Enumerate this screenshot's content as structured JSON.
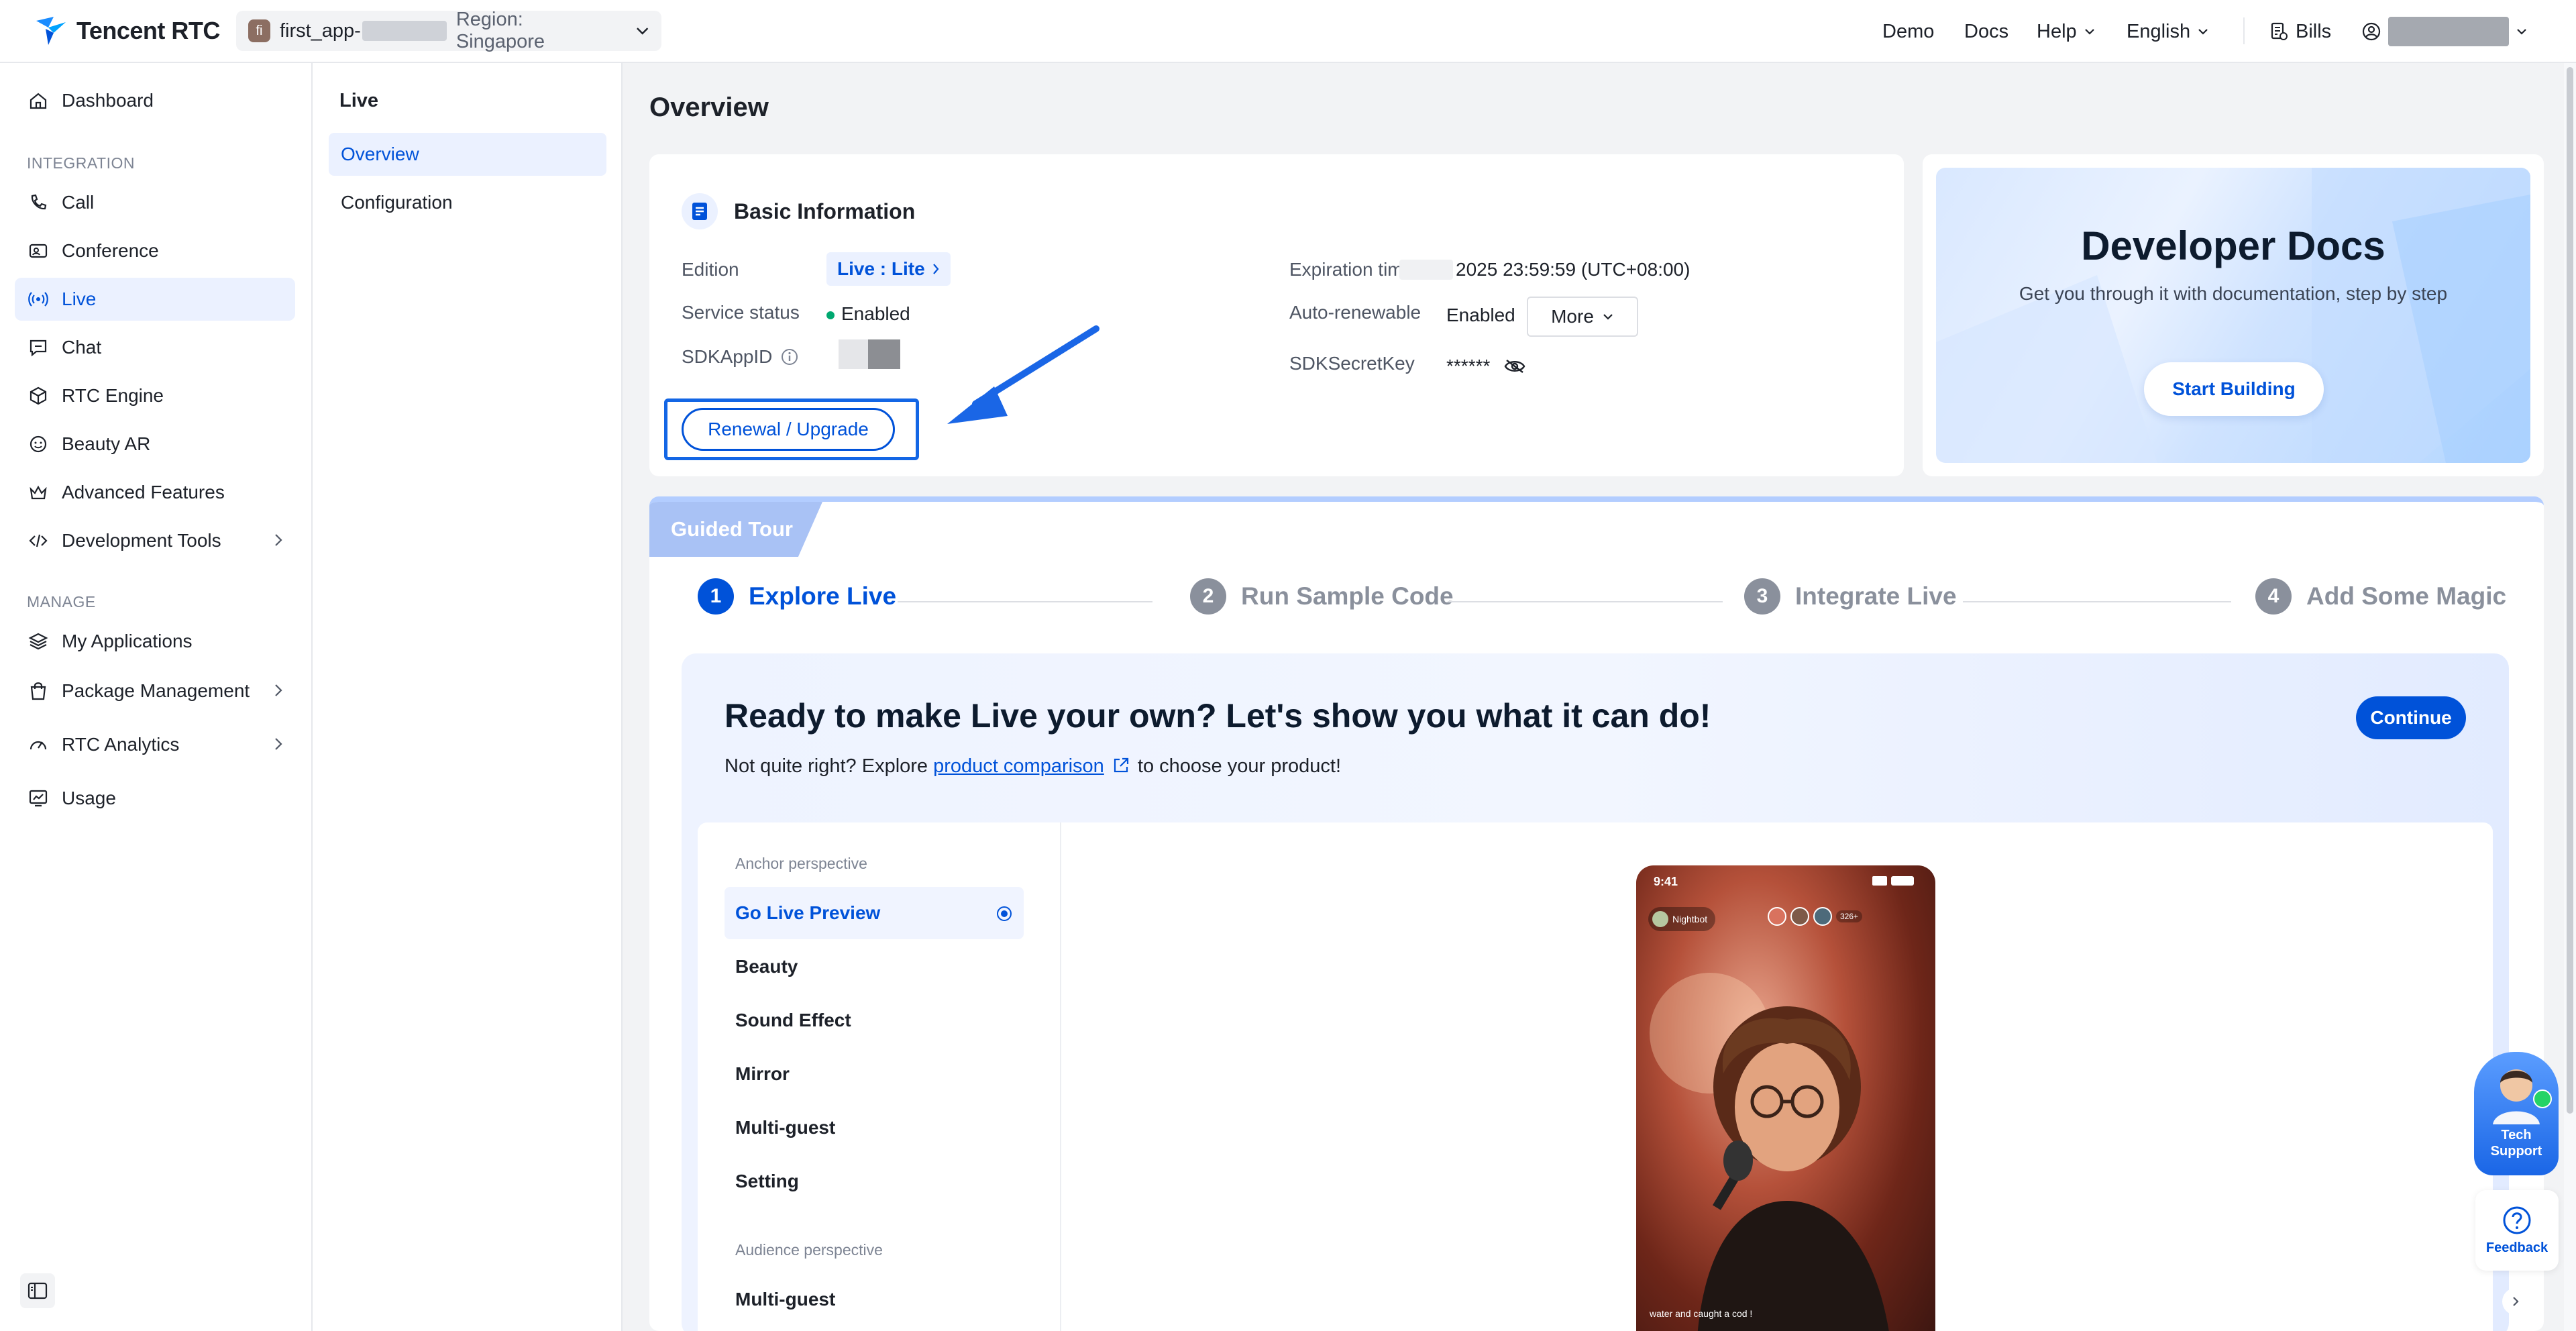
{
  "topbar": {
    "logo_text": "Tencent RTC",
    "app": {
      "avatar_letter": "fi",
      "name": "first_app-",
      "region": "Region: Singapore"
    },
    "nav": {
      "demo": "Demo",
      "docs": "Docs",
      "help": "Help",
      "language": "English",
      "bills": "Bills"
    }
  },
  "sidebar": {
    "dashboard": "Dashboard",
    "integration_label": "INTEGRATION",
    "call": "Call",
    "conference": "Conference",
    "live": "Live",
    "chat": "Chat",
    "rtc_engine": "RTC Engine",
    "beauty_ar": "Beauty AR",
    "advanced_features": "Advanced Features",
    "development_tools": "Development Tools",
    "manage_label": "MANAGE",
    "my_applications": "My Applications",
    "package_management": "Package Management",
    "rtc_analytics": "RTC Analytics",
    "usage": "Usage"
  },
  "subnav": {
    "title": "Live",
    "overview": "Overview",
    "configuration": "Configuration"
  },
  "page": {
    "title": "Overview"
  },
  "basic": {
    "title": "Basic Information",
    "edition_label": "Edition",
    "edition_value": "Live : Lite",
    "service_status_label": "Service status",
    "service_status_value": "Enabled",
    "sdkappid_label": "SDKAppID",
    "expiration_label": "Expiration time",
    "expiration_value": "2025 23:59:59 (UTC+08:00)",
    "auto_renew_label": "Auto-renewable",
    "auto_renew_value": "Enabled",
    "more_button": "More",
    "secret_label": "SDKSecretKey",
    "secret_value": "******",
    "renew_button": "Renewal / Upgrade"
  },
  "docs_card": {
    "title": "Developer Docs",
    "subtitle": "Get you through it with documentation, step by step",
    "button": "Start Building"
  },
  "tour": {
    "tab": "Guided Tour",
    "steps": [
      {
        "num": "1",
        "label": "Explore Live"
      },
      {
        "num": "2",
        "label": "Run Sample Code"
      },
      {
        "num": "3",
        "label": "Integrate Live"
      },
      {
        "num": "4",
        "label": "Add Some Magic"
      }
    ],
    "hero_title": "Ready to make Live your own? Let's show you what it can do!",
    "hero_sub_pre": "Not quite right? Explore ",
    "hero_link": "product comparison",
    "hero_sub_post": " to choose your product!",
    "continue": "Continue",
    "anchor_label": "Anchor perspective",
    "anchor_items": [
      "Go Live Preview",
      "Beauty",
      "Sound Effect",
      "Mirror",
      "Multi-guest",
      "Setting"
    ],
    "audience_label": "Audience perspective",
    "audience_items": [
      "Multi-guest"
    ],
    "phone": {
      "time": "9:41",
      "host": "Nightbot",
      "viewers": "326+",
      "comment": "water and caught a cod !"
    }
  },
  "floating": {
    "tech_support": "Tech Support",
    "feedback": "Feedback"
  },
  "colors": {
    "brand": "#0052d9",
    "highlight": "#1366e5",
    "status_green": "#00a870"
  }
}
